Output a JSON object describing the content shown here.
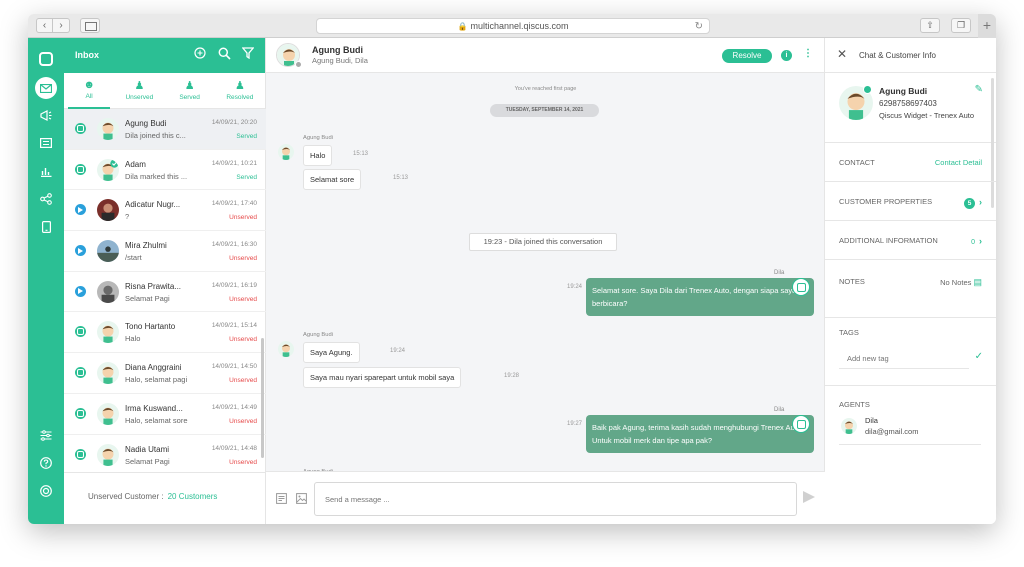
{
  "browser": {
    "url": "multichannel.qiscus.com"
  },
  "inbox": {
    "title": "Inbox",
    "filters": [
      {
        "label": "All",
        "icon": "user-circle-icon"
      },
      {
        "label": "Unserved",
        "icon": "user-plus-icon"
      },
      {
        "label": "Served",
        "icon": "user-minus-icon"
      },
      {
        "label": "Resolved",
        "icon": "user-check-icon"
      }
    ],
    "rooms": [
      {
        "name": "Agung Budi",
        "last": "Dila joined this c...",
        "time": "14/09/21, 20:20",
        "status": "Served",
        "channel": "whatsapp",
        "avatar": "cartoon"
      },
      {
        "name": "Adam",
        "last": "Dila marked this ...",
        "time": "14/09/21, 10:21",
        "status": "Served",
        "channel": "whatsapp",
        "avatar": "cartoon-check"
      },
      {
        "name": "Adicatur Nugr...",
        "last": "?",
        "time": "14/09/21, 17:40",
        "status": "Unserved",
        "channel": "telegram",
        "avatar": "photo-red"
      },
      {
        "name": "Mira Zhulmi",
        "last": "/start",
        "time": "14/09/21, 16:30",
        "status": "Unserved",
        "channel": "telegram",
        "avatar": "photo-sky"
      },
      {
        "name": "Risna Prawita...",
        "last": "Selamat Pagi",
        "time": "14/09/21, 16:19",
        "status": "Unserved",
        "channel": "telegram",
        "avatar": "photo-gray"
      },
      {
        "name": "Tono Hartanto",
        "last": "Halo",
        "time": "14/09/21, 15:14",
        "status": "Unserved",
        "channel": "whatsapp",
        "avatar": "cartoon"
      },
      {
        "name": "Diana Anggraini",
        "last": "Halo, selamat pagi",
        "time": "14/09/21, 14:50",
        "status": "Unserved",
        "channel": "whatsapp",
        "avatar": "cartoon"
      },
      {
        "name": "Irma Kuswand...",
        "last": "Halo, selamat sore",
        "time": "14/09/21, 14:49",
        "status": "Unserved",
        "channel": "whatsapp",
        "avatar": "cartoon"
      },
      {
        "name": "Nadia Utami",
        "last": "Selamat Pagi",
        "time": "14/09/21, 14:48",
        "status": "Unserved",
        "channel": "whatsapp",
        "avatar": "cartoon"
      }
    ],
    "footer_label": "Unserved Customer :",
    "footer_count": "20 Customers"
  },
  "chat": {
    "name": "Agung Budi",
    "participants": "Agung Budi, Dila",
    "resolve_label": "Resolve",
    "first_page": "You've reached first page",
    "date": "TUESDAY, SEPTEMBER 14, 2021",
    "system_msg": "19:23 - Dila joined this conversation",
    "sender_customer": "Agung Budi",
    "sender_agent": "Dila",
    "m1": "Halo",
    "m1_time": "15:13",
    "m2": "Selamat sore",
    "m2_time": "15:13",
    "m3": "Selamat sore. Saya Dila dari Trenex Auto, dengan siapa saya berbicara?",
    "m3_time": "19:24",
    "m4": "Saya Agung.",
    "m4_time": "19:24",
    "m5": "Saya mau nyari sparepart untuk mobil saya",
    "m5_time": "19:28",
    "m6": "Baik pak Agung, terima kasih sudah menghubungi Trenex Auto. Untuk mobil merk dan tipe apa pak?",
    "m6_time": "19:27",
    "placeholder": "Send a message ..."
  },
  "info": {
    "title": "Chat & Customer Info",
    "customer_name": "Agung Budi",
    "customer_phone": "6298758697403",
    "customer_source": "Qiscus Widget - Trenex Auto",
    "contact_label": "CONTACT",
    "contact_link": "Contact Detail",
    "props_label": "CUSTOMER PROPERTIES",
    "props_count": "5",
    "addl_label": "ADDITIONAL INFORMATION",
    "addl_count": "0",
    "notes_label": "NOTES",
    "notes_value": "No Notes",
    "tags_label": "TAGS",
    "tag_placeholder": "Add new tag",
    "agents_label": "AGENTS",
    "agent_name": "Dila",
    "agent_email": "dila@gmail.com"
  },
  "colors": {
    "primary": "#2bbf94",
    "agent_bubble": "#62a789",
    "unserved": "#e64949",
    "telegram": "#2aa0db"
  }
}
